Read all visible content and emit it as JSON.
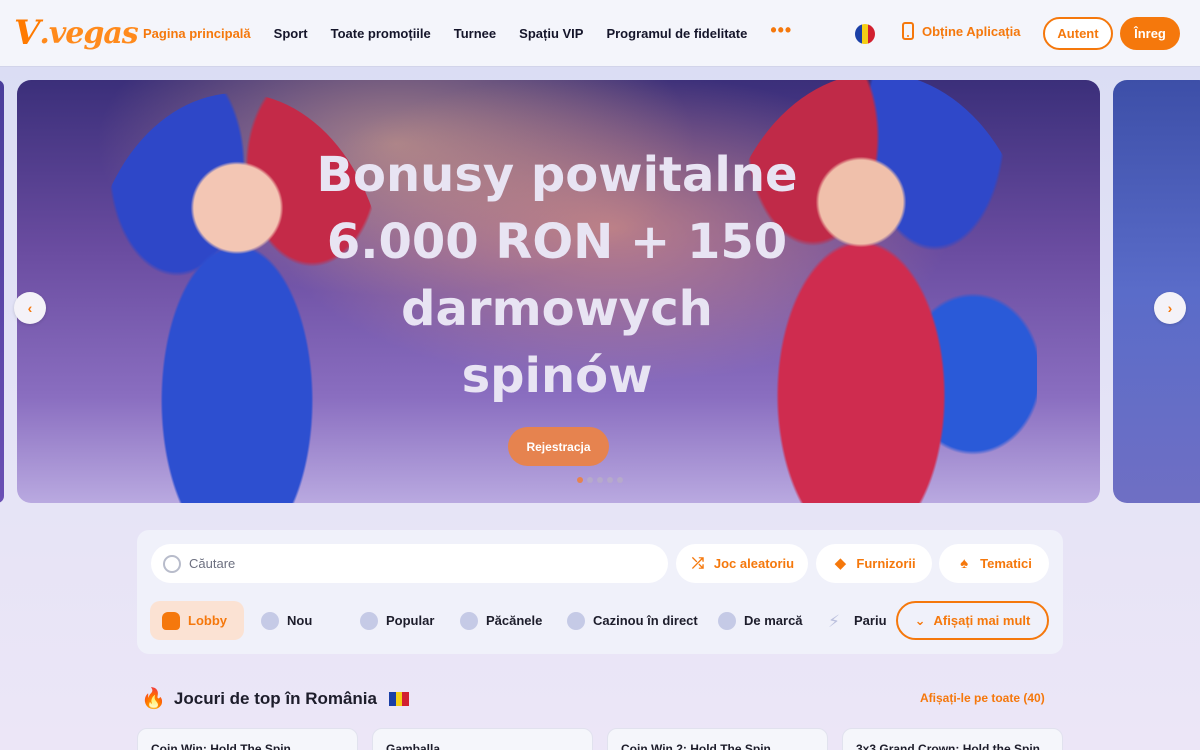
{
  "header": {
    "logo_text": "V.vegas",
    "nav": [
      {
        "label": "Pagina principală",
        "active": true
      },
      {
        "label": "Sport"
      },
      {
        "label": "Toate promoțiile"
      },
      {
        "label": "Turnee"
      },
      {
        "label": "Spațiu VIP"
      },
      {
        "label": "Programul de fidelitate"
      }
    ],
    "more_label": "•••",
    "get_app_label": "Obține Aplicația",
    "login_label": "Autent",
    "register_label": "Înreg"
  },
  "banner": {
    "title_lines": [
      "Bonusy powitalne",
      "6.000 RON + 150",
      "darmowych",
      "spinów"
    ],
    "cta_label": "Rejestracja",
    "slide_count": 5,
    "active_slide": 1,
    "prev_icon": "‹",
    "next_icon": "›"
  },
  "filters": {
    "search_placeholder": "Căutare",
    "random_label": "Joc aleatoriu",
    "providers_label": "Furnizorii",
    "themes_label": "Tematici",
    "categories": [
      {
        "label": "Lobby",
        "active": true
      },
      {
        "label": "Nou"
      },
      {
        "label": "Popular"
      },
      {
        "label": "Păcănele"
      },
      {
        "label": "Cazinou în direct"
      },
      {
        "label": "De marcă"
      },
      {
        "label": "Pariu"
      }
    ],
    "show_more_label": "Afișați mai mult"
  },
  "section": {
    "title": "Jocuri de top în România",
    "see_all_label": "Afișați-le pe toate (40)",
    "games": [
      "Coin Win: Hold The Spin",
      "Gamballa",
      "Coin Win 2: Hold The Spin",
      "3x3 Grand Crown: Hold the Spin"
    ]
  },
  "colors": {
    "accent": "#f5780c",
    "background": "#e4e3f6",
    "panel": "#f0f1fa"
  }
}
